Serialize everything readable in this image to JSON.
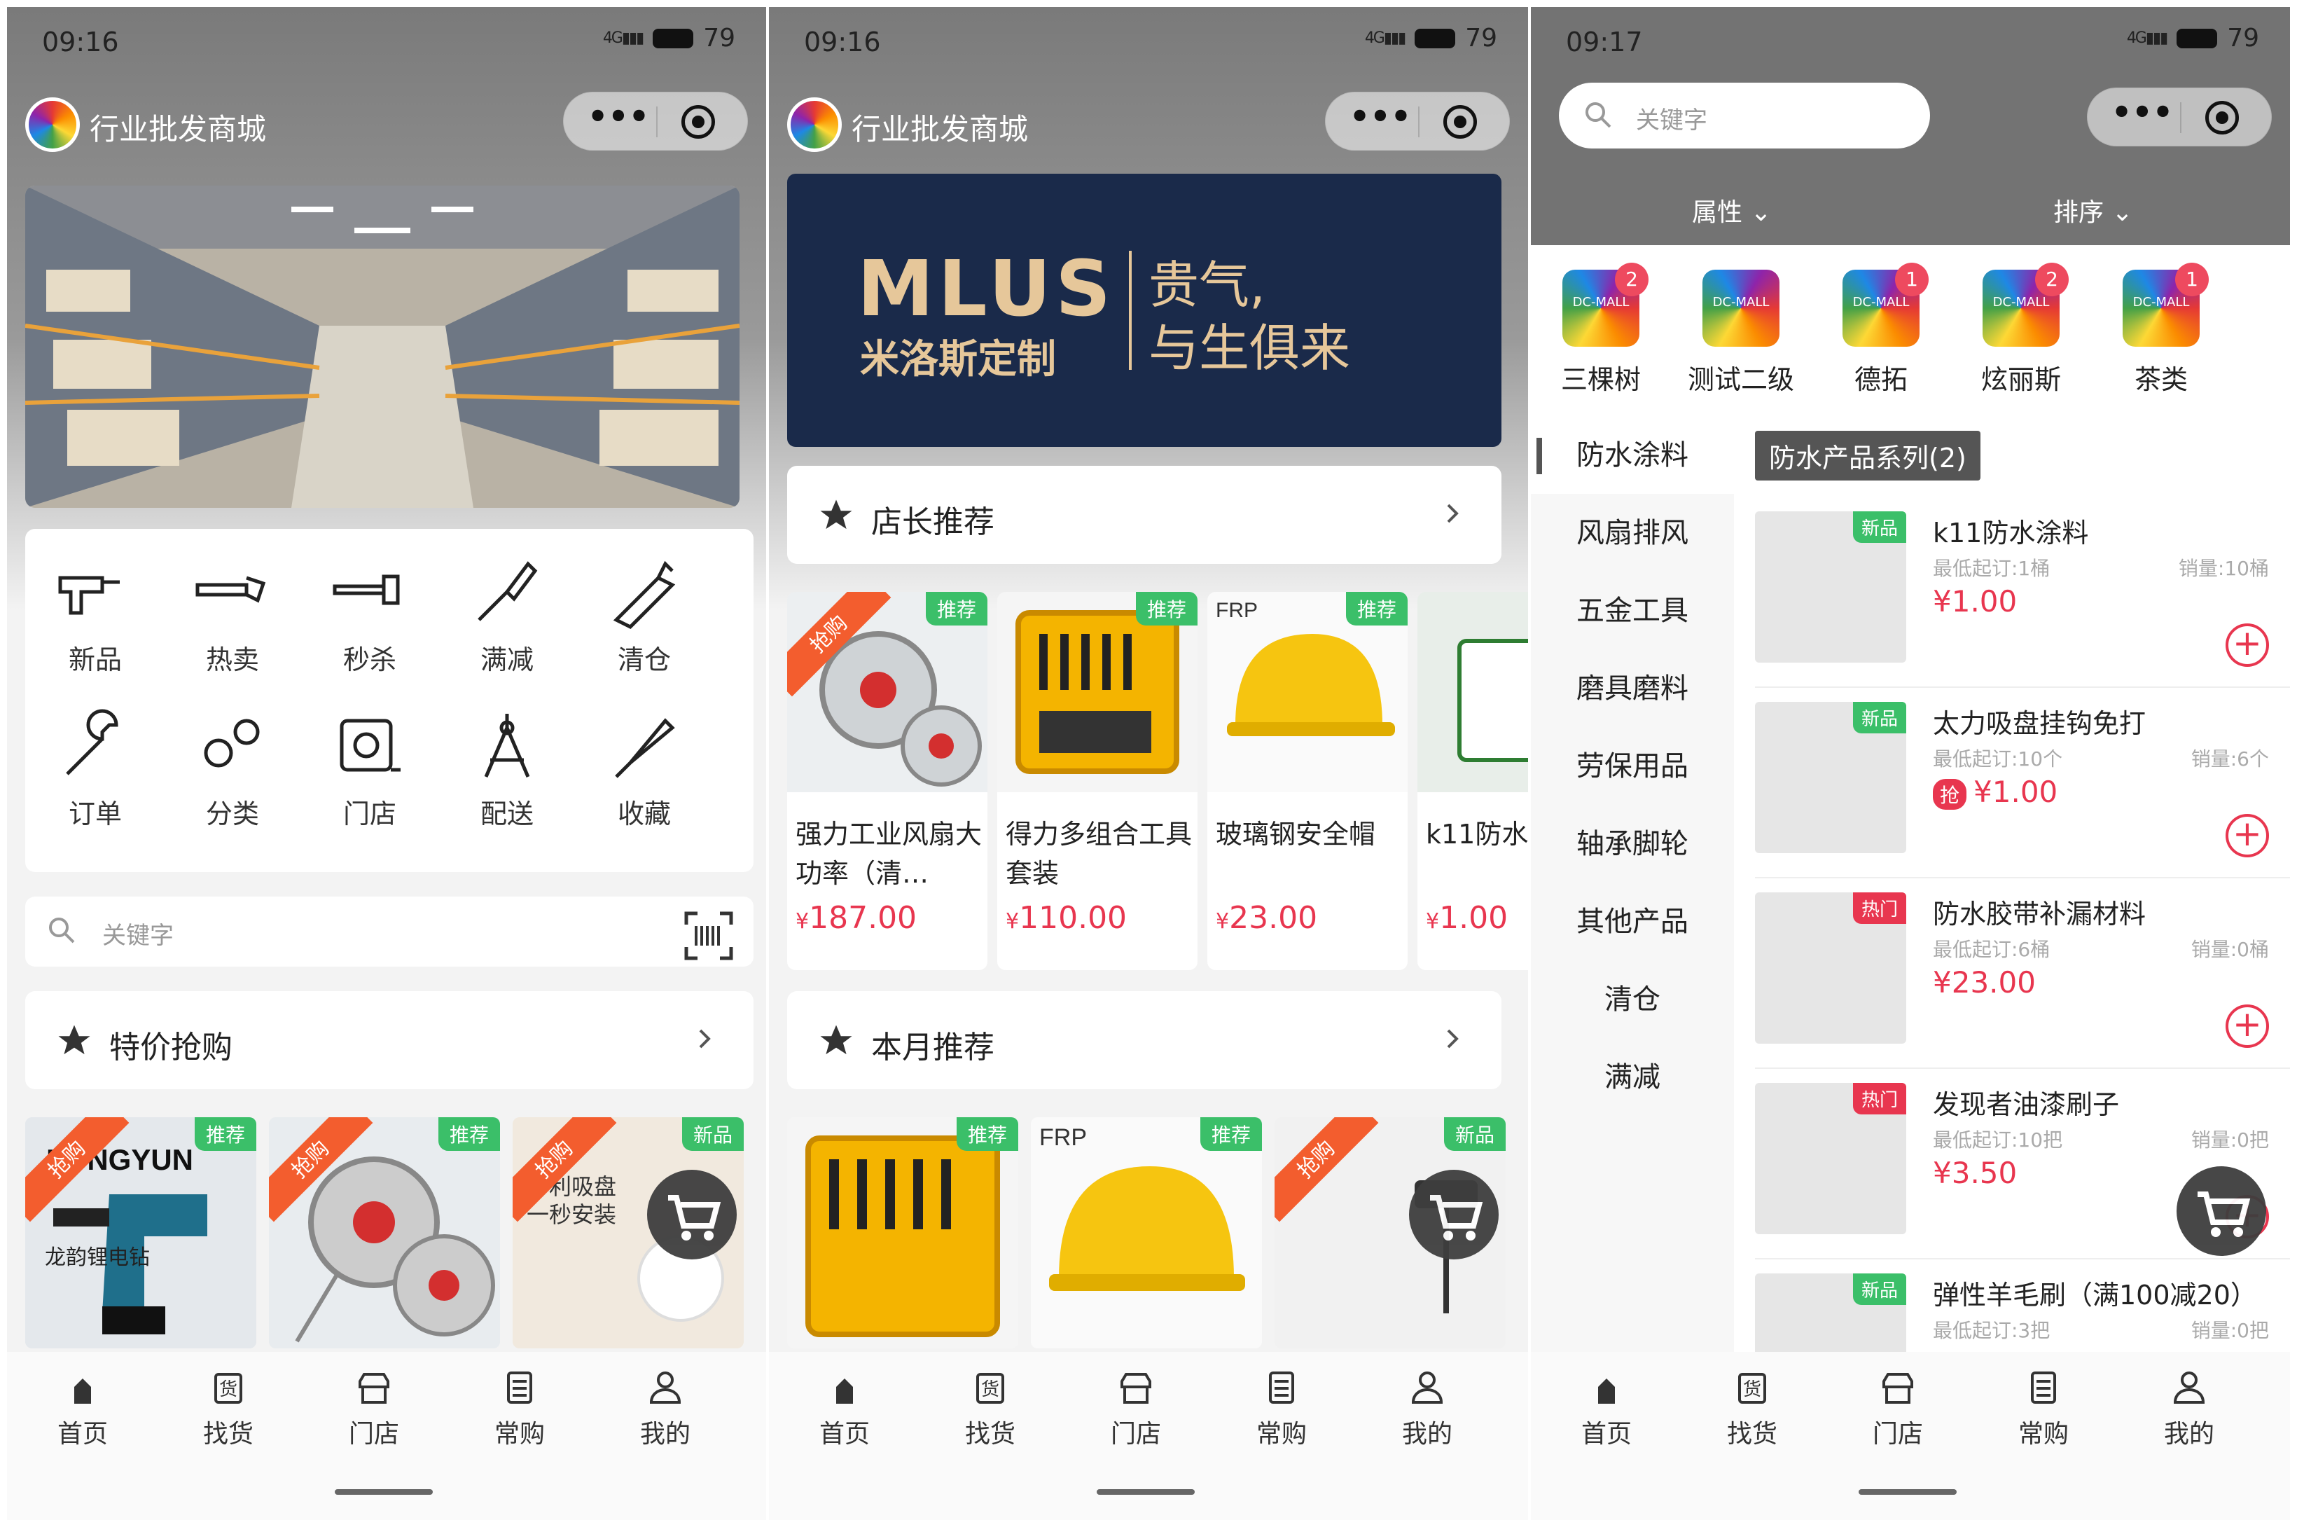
{
  "phones": [
    {
      "status": {
        "time": "09:16",
        "battery": "79"
      },
      "nav": {
        "title": "行业批发商城"
      },
      "grid": [
        "新品",
        "热卖",
        "秒杀",
        "满减",
        "清仓",
        "订单",
        "分类",
        "门店",
        "配送",
        "收藏"
      ],
      "search": {
        "placeholder": "关键字"
      },
      "section": "特价抢购",
      "deal_tags": [
        "推荐",
        "推荐",
        "新品"
      ],
      "deal_ribbon": "抢购"
    },
    {
      "status": {
        "time": "09:16",
        "battery": "79"
      },
      "nav": {
        "title": "行业批发商城"
      },
      "banner": {
        "brand": "MLUS",
        "brand_cn": "米洛斯定制",
        "slogan_1": "贵气,",
        "slogan_2": "与生俱来"
      },
      "section_1": "店长推荐",
      "products": [
        {
          "name": "强力工业风扇大功率（清…",
          "price": "187.00",
          "tag": "推荐",
          "ribbon": "抢购"
        },
        {
          "name": "得力多组合工具套装",
          "price": "110.00",
          "tag": "推荐"
        },
        {
          "name": "玻璃钢安全帽",
          "price": "23.00",
          "tag": "推荐"
        },
        {
          "name": "k11防水",
          "price": "1.00"
        }
      ],
      "section_2": "本月推荐",
      "month_tags": [
        "推荐",
        "推荐",
        "新品"
      ]
    },
    {
      "status": {
        "time": "09:17",
        "battery": "79"
      },
      "search": {
        "placeholder": "关键字"
      },
      "filters": {
        "attr": "属性",
        "sort": "排序"
      },
      "brands": [
        {
          "name": "三棵树",
          "badge": "2"
        },
        {
          "name": "测试二级",
          "badge": ""
        },
        {
          "name": "德拓",
          "badge": "1"
        },
        {
          "name": "炫丽斯",
          "badge": "2"
        },
        {
          "name": "茶类",
          "badge": "1"
        }
      ],
      "categories": [
        "防水涂料",
        "风扇排风",
        "五金工具",
        "磨具磨料",
        "劳保用品",
        "轴承脚轮",
        "其他产品",
        "清仓",
        "满减"
      ],
      "section_tag": "防水产品系列(2)",
      "items": [
        {
          "title": "k11防水涂料",
          "min": "最低起订:1桶",
          "sales": "销量:10桶",
          "price": "1.00",
          "tag": "新品",
          "grab": ""
        },
        {
          "title": "太力吸盘挂钩免打",
          "min": "最低起订:10个",
          "sales": "销量:6个",
          "price": "1.00",
          "tag": "新品",
          "grab": "抢"
        },
        {
          "title": "防水胶带补漏材料",
          "min": "最低起订:6桶",
          "sales": "销量:0桶",
          "price": "23.00",
          "tag": "热门",
          "grab": ""
        },
        {
          "title": "发现者油漆刷子",
          "min": "最低起订:10把",
          "sales": "销量:0把",
          "price": "3.50",
          "tag": "热门",
          "grab": ""
        },
        {
          "title": "弹性羊毛刷（满100减20）",
          "min": "最低起订:3把",
          "sales": "销量:0把",
          "price": "",
          "tag": "新品",
          "grab": ""
        }
      ]
    }
  ],
  "tabs": [
    "首页",
    "找货",
    "门店",
    "常购",
    "我的"
  ],
  "currency": "¥",
  "colors": {
    "price": "#e8364f",
    "tag_green": "#3bbf69",
    "tag_red": "#e8364f",
    "ribbon": "#f35d2e"
  }
}
